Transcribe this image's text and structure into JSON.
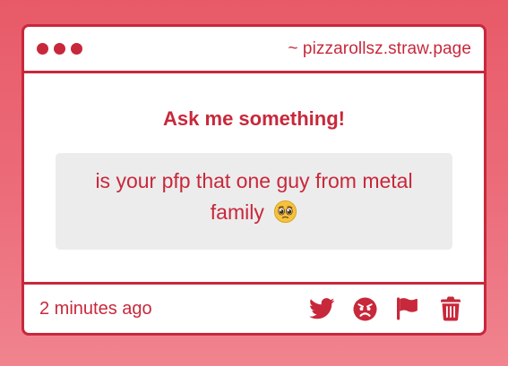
{
  "window": {
    "url": "~ pizzarollsz.straw.page"
  },
  "main": {
    "heading": "Ask me something!",
    "question": "is your pfp that one guy from metal family",
    "question_emoji": "pleading-face"
  },
  "footer": {
    "timestamp": "2 minutes ago",
    "actions": [
      {
        "icon": "twitter-icon"
      },
      {
        "icon": "angry-face-icon"
      },
      {
        "icon": "flag-icon"
      },
      {
        "icon": "trash-icon"
      }
    ]
  },
  "colors": {
    "accent": "#c8283b",
    "background": "#ec6d7b",
    "card": "#ffffff",
    "question_bg": "#ececec"
  }
}
